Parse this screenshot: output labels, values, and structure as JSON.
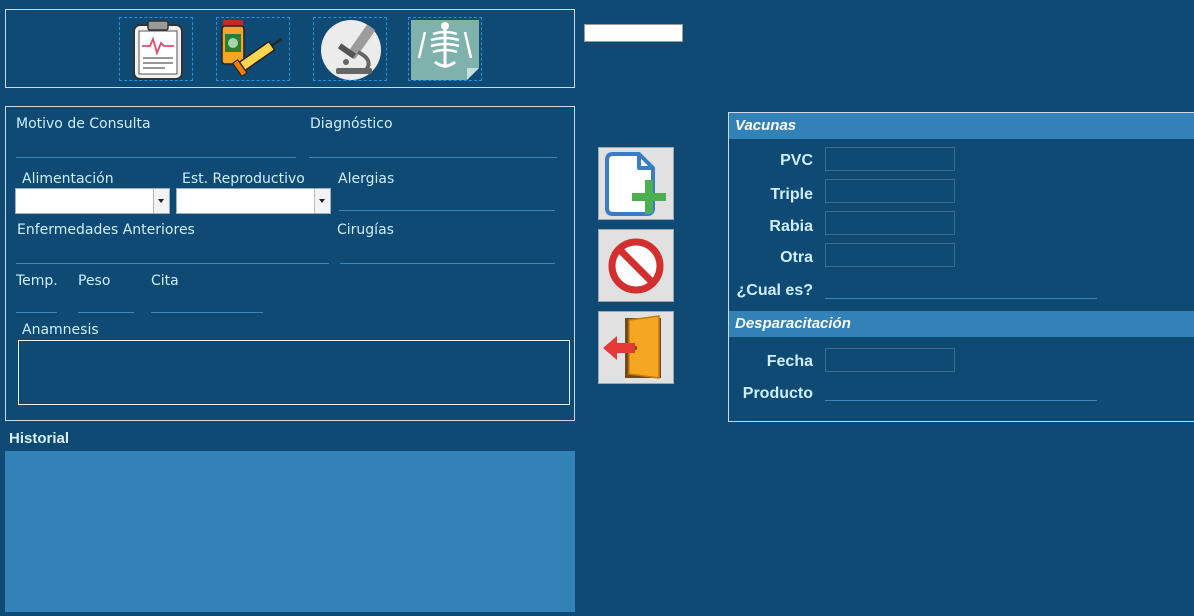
{
  "toolbar": {
    "icons": [
      "clipboard-icon",
      "vaccine-icon",
      "microscope-icon",
      "xray-icon"
    ]
  },
  "consulta": {
    "motivo_label": "Motivo de Consulta",
    "diagnostico_label": "Diagnóstico",
    "alimentacion_label": "Alimentación",
    "est_reproductivo_label": "Est. Reproductivo",
    "alergias_label": "Alergias",
    "enfermedades_label": "Enfermedades Anteriores",
    "cirugias_label": "Cirugías",
    "temp_label": "Temp.",
    "peso_label": "Peso",
    "cita_label": "Cita",
    "anamnesis_label": "Anamnesis"
  },
  "historial": {
    "label": "Historial"
  },
  "vacunas": {
    "header": "Vacunas",
    "pvc_label": "PVC",
    "triple_label": "Triple",
    "rabia_label": "Rabia",
    "otra_label": "Otra",
    "cual_label": "¿Cual es?"
  },
  "desparacitacion": {
    "header": "Desparacitación",
    "fecha_label": "Fecha",
    "producto_label": "Producto"
  },
  "colors": {
    "background": "#0e4a74",
    "section_header": "#3282b8",
    "historial_panel": "#3282b8"
  }
}
